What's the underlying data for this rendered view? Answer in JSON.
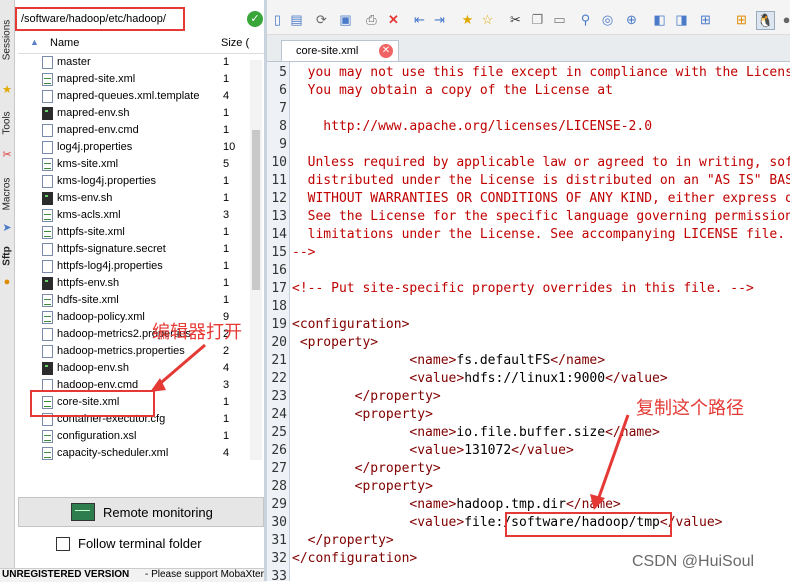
{
  "sidebar_tabs": [
    "Sessions",
    "Tools",
    "Macros",
    "Sftp"
  ],
  "path_input": "/software/hadoop/etc/hadoop/",
  "file_list": {
    "col_name": "Name",
    "col_size": "Size (",
    "files": [
      {
        "name": "master",
        "size": "1",
        "type": "file"
      },
      {
        "name": "mapred-site.xml",
        "size": "1",
        "type": "xml"
      },
      {
        "name": "mapred-queues.xml.template",
        "size": "4",
        "type": "file"
      },
      {
        "name": "mapred-env.sh",
        "size": "1",
        "type": "sh"
      },
      {
        "name": "mapred-env.cmd",
        "size": "1",
        "type": "file"
      },
      {
        "name": "log4j.properties",
        "size": "10",
        "type": "file"
      },
      {
        "name": "kms-site.xml",
        "size": "5",
        "type": "xml"
      },
      {
        "name": "kms-log4j.properties",
        "size": "1",
        "type": "file"
      },
      {
        "name": "kms-env.sh",
        "size": "1",
        "type": "sh"
      },
      {
        "name": "kms-acls.xml",
        "size": "3",
        "type": "xml"
      },
      {
        "name": "httpfs-site.xml",
        "size": "1",
        "type": "xml"
      },
      {
        "name": "httpfs-signature.secret",
        "size": "1",
        "type": "file"
      },
      {
        "name": "httpfs-log4j.properties",
        "size": "1",
        "type": "file"
      },
      {
        "name": "httpfs-env.sh",
        "size": "1",
        "type": "sh"
      },
      {
        "name": "hdfs-site.xml",
        "size": "1",
        "type": "xml"
      },
      {
        "name": "hadoop-policy.xml",
        "size": "9",
        "type": "xml"
      },
      {
        "name": "hadoop-metrics2.properties",
        "size": "2",
        "type": "file"
      },
      {
        "name": "hadoop-metrics.properties",
        "size": "2",
        "type": "file"
      },
      {
        "name": "hadoop-env.sh",
        "size": "4",
        "type": "sh"
      },
      {
        "name": "hadoop-env.cmd",
        "size": "3",
        "type": "file"
      },
      {
        "name": "core-site.xml",
        "size": "1",
        "type": "xml"
      },
      {
        "name": "container-executor.cfg",
        "size": "1",
        "type": "file"
      },
      {
        "name": "configuration.xsl",
        "size": "1",
        "type": "xml"
      },
      {
        "name": "capacity-scheduler.xml",
        "size": "4",
        "type": "xml"
      }
    ]
  },
  "remote_monitoring_label": "Remote monitoring",
  "follow_terminal_label": "Follow terminal folder",
  "status": {
    "unregistered": "UNREGISTERED VERSION",
    "support": "- Please support MobaXterm"
  },
  "editor": {
    "tab_label": "core-site.xml",
    "lines": [
      {
        "n": "5",
        "segs": [
          {
            "t": "  you may not use this file except in compliance with the License.",
            "k": "c"
          }
        ]
      },
      {
        "n": "6",
        "segs": [
          {
            "t": "  You may obtain a copy of the License at",
            "k": "c"
          }
        ]
      },
      {
        "n": "7",
        "segs": []
      },
      {
        "n": "8",
        "segs": [
          {
            "t": "    http://www.apache.org/licenses/LICENSE-2.0",
            "k": "c"
          }
        ]
      },
      {
        "n": "9",
        "segs": []
      },
      {
        "n": "10",
        "segs": [
          {
            "t": "  Unless required by applicable law or agreed to in writing, software",
            "k": "c"
          }
        ]
      },
      {
        "n": "11",
        "segs": [
          {
            "t": "  distributed under the License is distributed on an \"AS IS\" BASIS,",
            "k": "c"
          }
        ]
      },
      {
        "n": "12",
        "segs": [
          {
            "t": "  WITHOUT WARRANTIES OR CONDITIONS OF ANY KIND, either express or implied.",
            "k": "c"
          }
        ]
      },
      {
        "n": "13",
        "segs": [
          {
            "t": "  See the License for the specific language governing permissions and",
            "k": "c"
          }
        ]
      },
      {
        "n": "14",
        "segs": [
          {
            "t": "  limitations under the License. See accompanying LICENSE file.",
            "k": "c"
          }
        ]
      },
      {
        "n": "15",
        "segs": [
          {
            "t": "-->",
            "k": "c"
          }
        ]
      },
      {
        "n": "16",
        "segs": []
      },
      {
        "n": "17",
        "segs": [
          {
            "t": "<!-- Put site-specific property overrides in this file. -->",
            "k": "c"
          }
        ]
      },
      {
        "n": "18",
        "segs": []
      },
      {
        "n": "19",
        "segs": [
          {
            "t": "<configuration>",
            "k": "t"
          }
        ]
      },
      {
        "n": "20",
        "segs": [
          {
            "t": " <property>",
            "k": "t"
          }
        ]
      },
      {
        "n": "21",
        "segs": [
          {
            "t": "               ",
            "k": "v"
          },
          {
            "t": "<name>",
            "k": "t"
          },
          {
            "t": "fs.defaultFS",
            "k": "v"
          },
          {
            "t": "</name>",
            "k": "t"
          }
        ]
      },
      {
        "n": "22",
        "segs": [
          {
            "t": "               ",
            "k": "v"
          },
          {
            "t": "<value>",
            "k": "t"
          },
          {
            "t": "hdfs://linux1:9000",
            "k": "v"
          },
          {
            "t": "</value>",
            "k": "t"
          }
        ]
      },
      {
        "n": "23",
        "segs": [
          {
            "t": "        ",
            "k": "v"
          },
          {
            "t": "</property>",
            "k": "t"
          }
        ]
      },
      {
        "n": "24",
        "segs": [
          {
            "t": "        ",
            "k": "v"
          },
          {
            "t": "<property>",
            "k": "t"
          }
        ]
      },
      {
        "n": "25",
        "segs": [
          {
            "t": "               ",
            "k": "v"
          },
          {
            "t": "<name>",
            "k": "t"
          },
          {
            "t": "io.file.buffer.size",
            "k": "v"
          },
          {
            "t": "</name>",
            "k": "t"
          }
        ]
      },
      {
        "n": "26",
        "segs": [
          {
            "t": "               ",
            "k": "v"
          },
          {
            "t": "<value>",
            "k": "t"
          },
          {
            "t": "131072",
            "k": "v"
          },
          {
            "t": "</value>",
            "k": "t"
          }
        ]
      },
      {
        "n": "27",
        "segs": [
          {
            "t": "        ",
            "k": "v"
          },
          {
            "t": "</property>",
            "k": "t"
          }
        ]
      },
      {
        "n": "28",
        "segs": [
          {
            "t": "        ",
            "k": "v"
          },
          {
            "t": "<property>",
            "k": "t"
          }
        ]
      },
      {
        "n": "29",
        "segs": [
          {
            "t": "               ",
            "k": "v"
          },
          {
            "t": "<name>",
            "k": "t"
          },
          {
            "t": "hadoop.tmp.dir",
            "k": "v"
          },
          {
            "t": "</name>",
            "k": "t"
          }
        ]
      },
      {
        "n": "30",
        "segs": [
          {
            "t": "               ",
            "k": "v"
          },
          {
            "t": "<value>",
            "k": "t"
          },
          {
            "t": "file:/software/hadoop/tmp",
            "k": "v"
          },
          {
            "t": "</value>",
            "k": "t"
          }
        ]
      },
      {
        "n": "31",
        "segs": [
          {
            "t": "  ",
            "k": "v"
          },
          {
            "t": "</property>",
            "k": "t"
          }
        ]
      },
      {
        "n": "32",
        "segs": [
          {
            "t": "</configuration>",
            "k": "t"
          }
        ]
      },
      {
        "n": "33",
        "segs": []
      }
    ]
  },
  "annotations": {
    "open_with_editor": "编辑器打开",
    "copy_this_path": "复制这个路径"
  },
  "watermark": "CSDN @HuiSoul",
  "colors": {
    "comment": "#c00000",
    "tag": "#800000",
    "annotation": "#e53935"
  }
}
